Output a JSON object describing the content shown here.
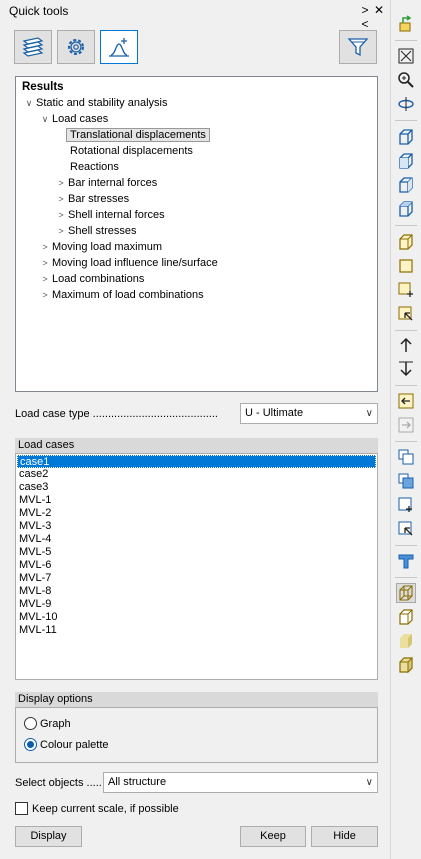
{
  "window": {
    "title": "Quick tools",
    "controls": [
      "><",
      "✕"
    ]
  },
  "toolbar": {
    "buttons": [
      "layers-icon",
      "gear-icon",
      "graph-add-icon"
    ],
    "filter": "filter-icon"
  },
  "tree": {
    "root": "Results",
    "analysis": "Static and stability analysis",
    "load_cases": "Load cases",
    "items": [
      "Translational displacements",
      "Rotational displacements",
      "Reactions",
      "Bar internal forces",
      "Bar stresses",
      "Shell internal forces",
      "Shell stresses"
    ],
    "siblings": [
      "Moving load maximum",
      "Moving load influence line/surface",
      "Load combinations",
      "Maximum of load combinations"
    ]
  },
  "load_case_type": {
    "label": "Load case type .........................................",
    "value": "U - Ultimate"
  },
  "load_cases": {
    "header": "Load cases",
    "items": [
      "case1",
      "case2",
      "case3",
      "MVL-1",
      "MVL-2",
      "MVL-3",
      "MVL-4",
      "MVL-5",
      "MVL-6",
      "MVL-7",
      "MVL-8",
      "MVL-9",
      "MVL-10",
      "MVL-11"
    ],
    "selected": 0
  },
  "display_options": {
    "header": "Display options",
    "graph": "Graph",
    "palette": "Colour palette"
  },
  "select_objects": {
    "label": "Select objects .....",
    "value": "All structure"
  },
  "keep_scale": "Keep current scale, if possible",
  "buttons": {
    "display": "Display",
    "keep": "Keep",
    "hide": "Hide"
  },
  "colors": {
    "accent": "#0078d7",
    "selection": "#0078d7"
  }
}
